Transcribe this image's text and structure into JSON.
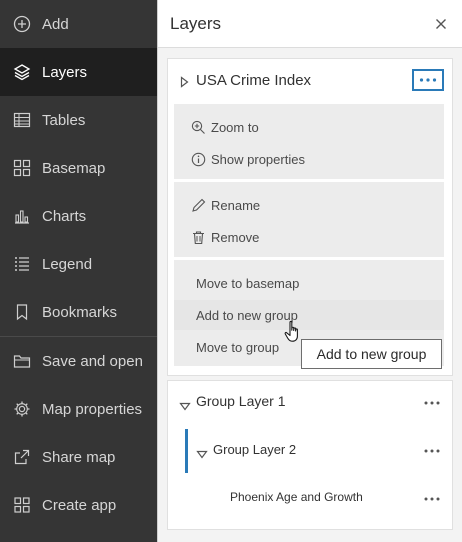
{
  "sidebar": {
    "items": [
      {
        "label": "Add",
        "icon": "plus-circle-icon"
      },
      {
        "label": "Layers",
        "icon": "layers-icon"
      },
      {
        "label": "Tables",
        "icon": "table-icon"
      },
      {
        "label": "Basemap",
        "icon": "basemap-icon"
      },
      {
        "label": "Charts",
        "icon": "chart-icon"
      },
      {
        "label": "Legend",
        "icon": "legend-icon"
      },
      {
        "label": "Bookmarks",
        "icon": "bookmark-icon"
      },
      {
        "label": "Save and open",
        "icon": "folder-icon"
      },
      {
        "label": "Map properties",
        "icon": "gear-icon"
      },
      {
        "label": "Share map",
        "icon": "share-icon"
      },
      {
        "label": "Create app",
        "icon": "apps-icon"
      }
    ],
    "active": "Layers"
  },
  "panel": {
    "title": "Layers",
    "close_icon": "close-icon"
  },
  "layer": {
    "name": "USA Crime Index",
    "menu": {
      "zoom_to": "Zoom to",
      "show_properties": "Show properties",
      "rename": "Rename",
      "remove": "Remove",
      "move_to_basemap": "Move to basemap",
      "add_to_new_group": "Add to new group",
      "move_to_group": "Move to group"
    }
  },
  "tooltip": "Add to new group",
  "groups": {
    "group1": "Group Layer 1",
    "group2": "Group Layer 2",
    "child": "Phoenix Age and Growth"
  },
  "colors": {
    "accent": "#2a7ab8",
    "sidebar_bg": "#353535",
    "sidebar_active": "#1f1f1f"
  }
}
